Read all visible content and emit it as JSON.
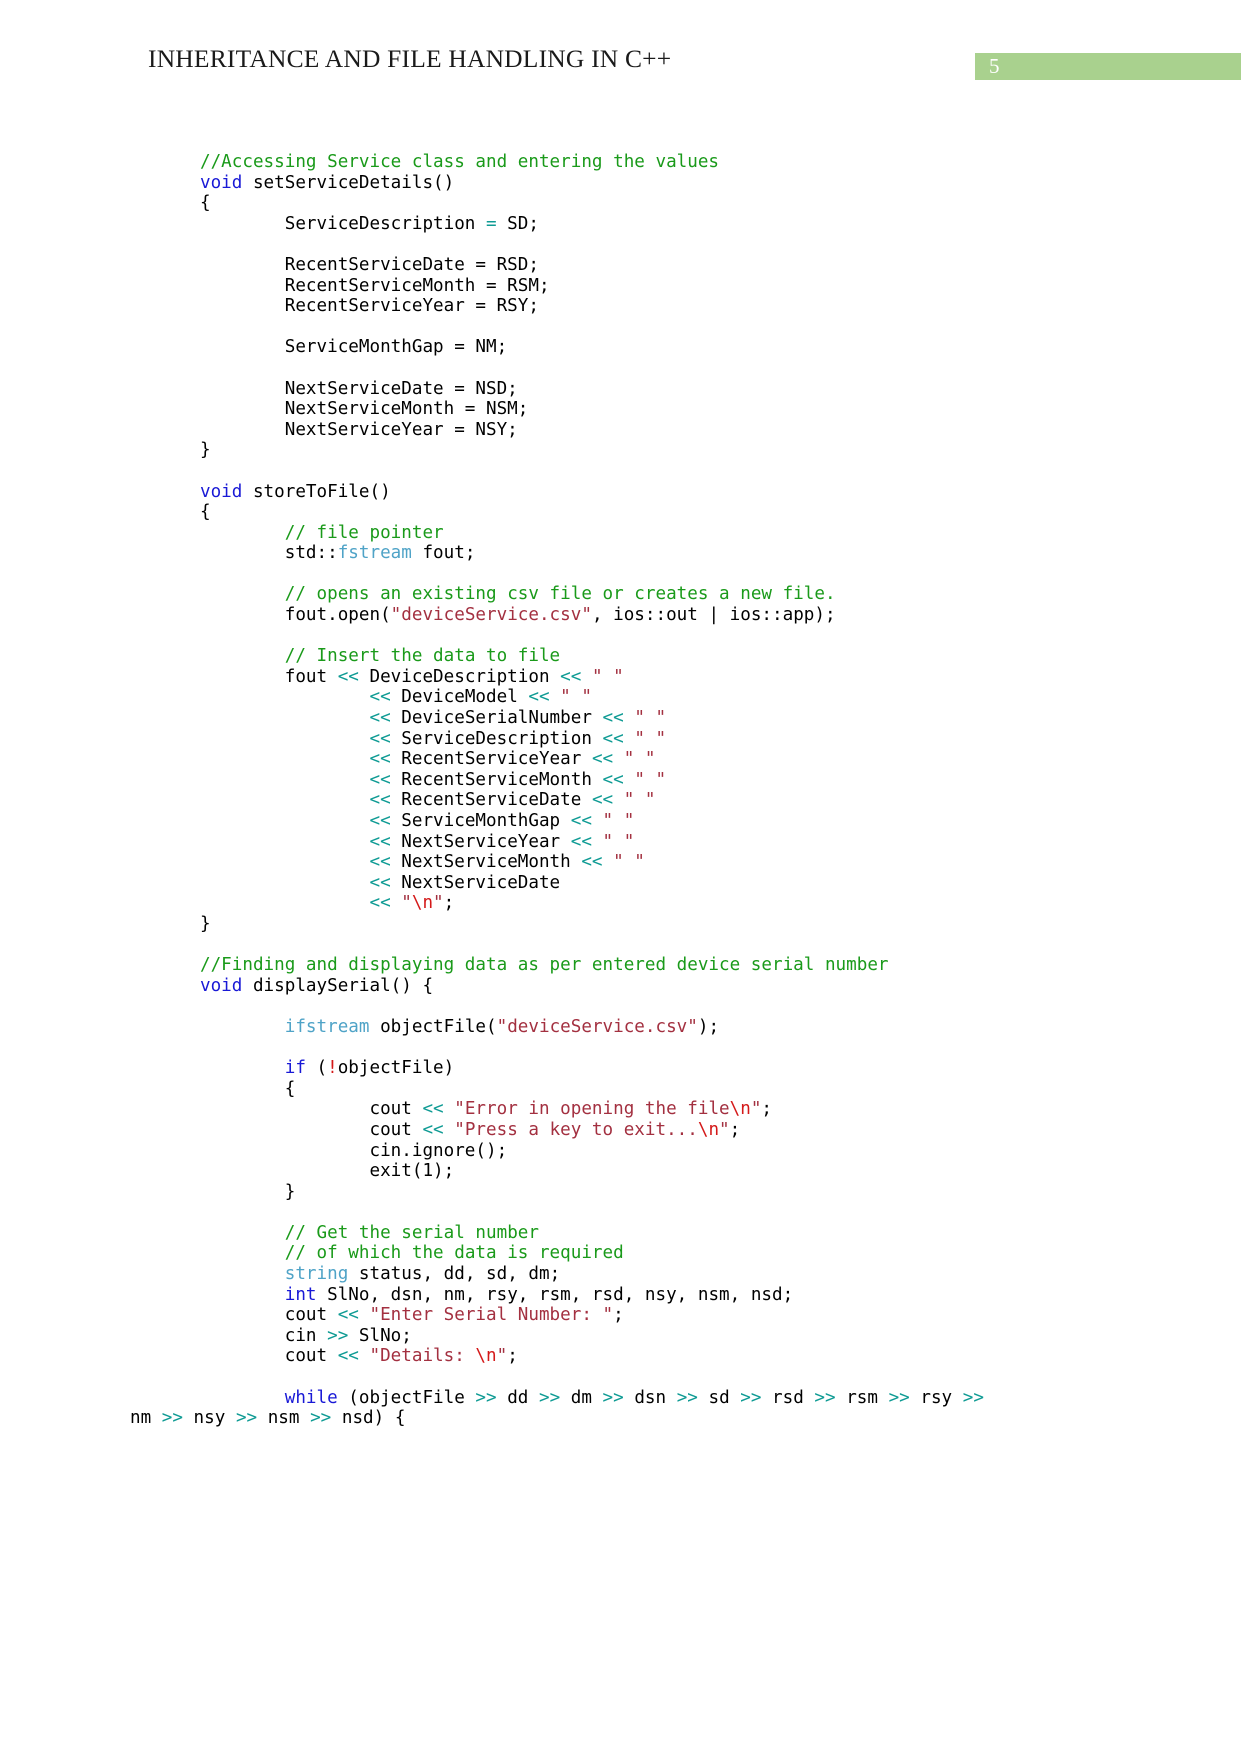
{
  "header": {
    "title": "INHERITANCE AND FILE HANDLING IN C++",
    "page_number": "5",
    "badge_color": "#a9d18e"
  },
  "colors": {
    "comment": "#1a9a1a",
    "keyword": "#1919d6",
    "type": "#4fa3c7",
    "operator": "#0f9b94",
    "string": "#a33040",
    "escape": "#d41919",
    "plain": "#000000"
  },
  "code": {
    "language": "C++",
    "lines": [
      "//Accessing Service class and entering the values",
      "void setServiceDetails()",
      "{",
      "        ServiceDescription = SD;",
      "",
      "        RecentServiceDate = RSD;",
      "        RecentServiceMonth = RSM;",
      "        RecentServiceYear = RSY;",
      "",
      "        ServiceMonthGap = NM;",
      "",
      "        NextServiceDate = NSD;",
      "        NextServiceMonth = NSM;",
      "        NextServiceYear = NSY;",
      "}",
      "",
      "void storeToFile()",
      "{",
      "        // file pointer",
      "        std::fstream fout;",
      "",
      "        // opens an existing csv file or creates a new file.",
      "        fout.open(\"deviceService.csv\", ios::out | ios::app);",
      "",
      "        // Insert the data to file",
      "        fout << DeviceDescription << \" \"",
      "                << DeviceModel << \" \"",
      "                << DeviceSerialNumber << \" \"",
      "                << ServiceDescription << \" \"",
      "                << RecentServiceYear << \" \"",
      "                << RecentServiceMonth << \" \"",
      "                << RecentServiceDate << \" \"",
      "                << ServiceMonthGap << \" \"",
      "                << NextServiceYear << \" \"",
      "                << NextServiceMonth << \" \"",
      "                << NextServiceDate",
      "                << \"\\n\";",
      "}",
      "",
      "//Finding and displaying data as per entered device serial number",
      "void displaySerial() {",
      "",
      "        ifstream objectFile(\"deviceService.csv\");",
      "",
      "        if (!objectFile)",
      "        {",
      "                cout << \"Error in opening the file\\n\";",
      "                cout << \"Press a key to exit...\\n\";",
      "                cin.ignore();",
      "                exit(1);",
      "        }",
      "",
      "        // Get the serial number",
      "        // of which the data is required",
      "        string status, dd, sd, dm;",
      "        int SlNo, dsn, nm, rsy, rsm, rsd, nsy, nsm, nsd;",
      "        cout << \"Enter Serial Number: \";",
      "        cin >> SlNo;",
      "        cout << \"Details: \\n\";",
      "",
      "        while (objectFile >> dd >> dm >> dsn >> sd >> rsd >> rsm >> rsy >>",
      "nm >> nsy >> nsm >> nsd) {"
    ]
  }
}
